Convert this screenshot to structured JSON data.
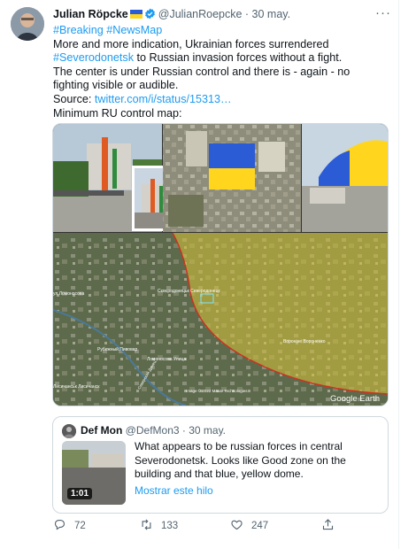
{
  "tweet": {
    "author_name": "Julian Röpcke",
    "handle": "@JulianRoepcke",
    "date": "· 30 may.",
    "more": "···",
    "text_line_hashtags_1": "#Breaking",
    "text_line_hashtags_2": "#NewsMap",
    "p1_a": "More and more indication, Ukrainian forces surrendered ",
    "p1_tag": "#Severodonetsk",
    "p1_b": " to Russian invasion forces without a fight.",
    "p2": "The center is under Russian control and there is - again - no fighting visible or audible.",
    "source_label": "Source: ",
    "source_link": "twitter.com/i/status/15313…",
    "p3": "Minimum RU control map:"
  },
  "media": {
    "map_label_center": "Сєвєродонецьк Северодонецк",
    "map_label_right": "Вороніне Вороненко",
    "map_label_left_top": "ул Ломоносова",
    "map_label_left_mid": "Рубежный Пивовар",
    "map_label_lower": "Ломоносова Улица",
    "map_label_bottom_left": "Лисичанськ Лисичанск",
    "map_label_river": "Северский Донец",
    "map_credit": "Image © 2022 Maxar Technologies",
    "brand": "Google Earth",
    "colors": {
      "control_zone": "#d8c23a",
      "flag_blue": "#2c5bd6",
      "flag_yellow": "#ffd51e"
    }
  },
  "quote": {
    "author_name": "Def Mon",
    "handle": "@DefMon3",
    "date": "· 30 may.",
    "text": "What appears to be russian forces in central Severodonetsk. Looks like Good zone on the building and that blue, yellow dome.",
    "duration": "1:01",
    "show_thread": "Mostrar este hilo"
  },
  "actions": {
    "replies": "72",
    "retweets": "133",
    "likes": "247"
  },
  "icons": {
    "verified": "verified-badge-icon",
    "reply": "reply-icon",
    "retweet": "retweet-icon",
    "like": "heart-icon",
    "share": "share-icon"
  }
}
